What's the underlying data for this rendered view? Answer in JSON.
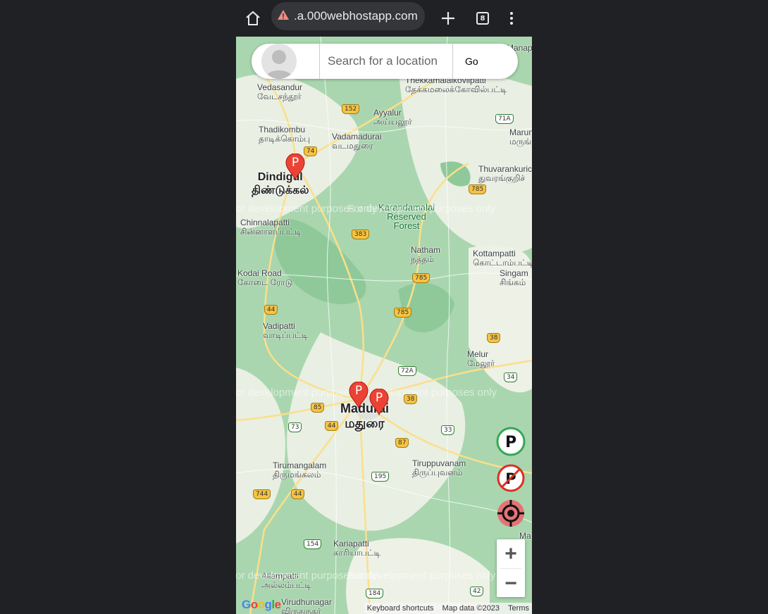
{
  "browser": {
    "url": ".a.000webhostapp.com",
    "tab_count": "8",
    "icons": [
      "home-icon",
      "warning-icon",
      "new-tab-icon",
      "tab-switcher-icon",
      "menu-icon"
    ]
  },
  "search": {
    "placeholder": "Search for a location",
    "go_label": "Go"
  },
  "map": {
    "places": [
      {
        "en": "Vedasandur",
        "ta": "வேடசந்தூர்"
      },
      {
        "en": "Thekkamalaikovilpatti",
        "ta": "தேக்கமலைக்கோவில்பட்டி"
      },
      {
        "en": "Ayyalur",
        "ta": "அய்யலூர்"
      },
      {
        "en": "Thadikombu",
        "ta": "தாடிக்கொம்பு"
      },
      {
        "en": "Vadamadurai",
        "ta": "வடமதுரை"
      },
      {
        "en": "Marun",
        "ta": "மருங்"
      },
      {
        "en": "Dindigul",
        "ta": "திண்டுக்கல்"
      },
      {
        "en": "Thuvarankurichi",
        "ta": "துவரங்குறிச்"
      },
      {
        "en": "Chinnalapatti",
        "ta": "சின்னாளப்பட்டி"
      },
      {
        "en": "Karandamalai Reserved Forest",
        "ta": ""
      },
      {
        "en": "Natham",
        "ta": "நத்தம்"
      },
      {
        "en": "Kottampatti",
        "ta": "கொட்டாம்பட்டி"
      },
      {
        "en": "Singam",
        "ta": "சிங்கம்"
      },
      {
        "en": "Kodai Road",
        "ta": "கோடை ரோடு"
      },
      {
        "en": "Vadipatti",
        "ta": "வாடிப்பட்டி"
      },
      {
        "en": "Melur",
        "ta": "மேலூர்"
      },
      {
        "en": "Madurai",
        "ta": "மதுரை"
      },
      {
        "en": "Tirumangalam",
        "ta": "திருமங்கலம்"
      },
      {
        "en": "Tiruppuvanam",
        "ta": "திருப்புவனம்"
      },
      {
        "en": "Kariapatti",
        "ta": "காரியாபட்டி"
      },
      {
        "en": "Allampatti",
        "ta": "அல்லம்பட்டி"
      },
      {
        "en": "Virudhunagar",
        "ta": "விருதுநகர்"
      },
      {
        "en": "Manap",
        "ta": ""
      },
      {
        "en": "Ma",
        "ta": ""
      }
    ],
    "routes": [
      "152",
      "71A",
      "74",
      "785",
      "383",
      "785",
      "785",
      "44",
      "38",
      "72A",
      "34",
      "85",
      "38",
      "73",
      "44",
      "33",
      "87",
      "195",
      "744",
      "44",
      "154",
      "184",
      "42"
    ],
    "watermark": "For development purposes only",
    "marker_label": "P",
    "footer": {
      "shortcuts": "Keyboard shortcuts",
      "mapdata": "Map data ©2023",
      "terms": "Terms"
    },
    "logo": "Google",
    "zoom_in": "+",
    "zoom_out": "−"
  },
  "colors": {
    "map_green": "#a9d6ae",
    "map_land": "#e9efe2",
    "marker_red": "#ea4335",
    "parking_green": "#34a853",
    "no_parking_red": "#d93025"
  }
}
